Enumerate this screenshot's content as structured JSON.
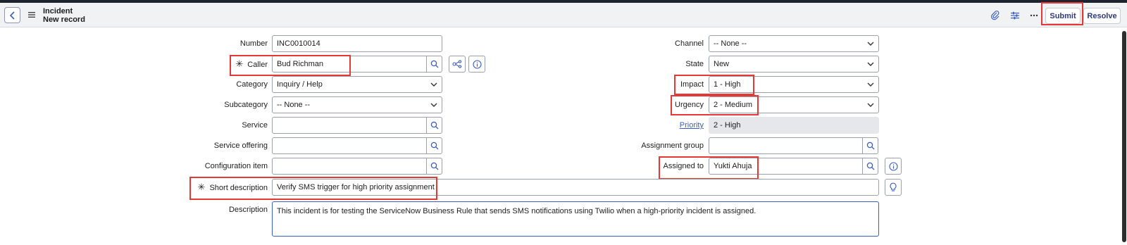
{
  "header": {
    "title": "Incident",
    "subtitle": "New record",
    "submit_label": "Submit",
    "resolve_label": "Resolve",
    "icons": [
      "back-icon",
      "menu-icon",
      "attachment-icon",
      "settings-sliders-icon",
      "more-icon"
    ]
  },
  "left": {
    "number": {
      "label": "Number",
      "value": "INC0010014"
    },
    "caller": {
      "label": "Caller",
      "value": "Bud Richman"
    },
    "category": {
      "label": "Category",
      "value": "Inquiry / Help"
    },
    "subcategory": {
      "label": "Subcategory",
      "value": "-- None --"
    },
    "service": {
      "label": "Service",
      "value": ""
    },
    "service_offering": {
      "label": "Service offering",
      "value": ""
    },
    "configuration_item": {
      "label": "Configuration item",
      "value": ""
    }
  },
  "right": {
    "channel": {
      "label": "Channel",
      "value": "-- None --"
    },
    "state": {
      "label": "State",
      "value": "New"
    },
    "impact": {
      "label": "Impact",
      "value": "1 - High"
    },
    "urgency": {
      "label": "Urgency",
      "value": "2 - Medium"
    },
    "priority": {
      "label": "Priority",
      "value": "2 - High"
    },
    "assignment_group": {
      "label": "Assignment group",
      "value": ""
    },
    "assigned_to": {
      "label": "Assigned to",
      "value": "Yukti Ahuja"
    }
  },
  "short_description": {
    "label": "Short description",
    "value": "Verify SMS trigger for high priority assignment"
  },
  "description": {
    "label": "Description",
    "value": "This incident is for testing the ServiceNow Business Rule that sends SMS notifications using Twilio when a high-priority incident is assigned."
  },
  "colors": {
    "accent": "#3b5ec4",
    "highlight": "#e53935",
    "header_bg": "#f1f2f4",
    "button_text": "#2e3a7c"
  }
}
